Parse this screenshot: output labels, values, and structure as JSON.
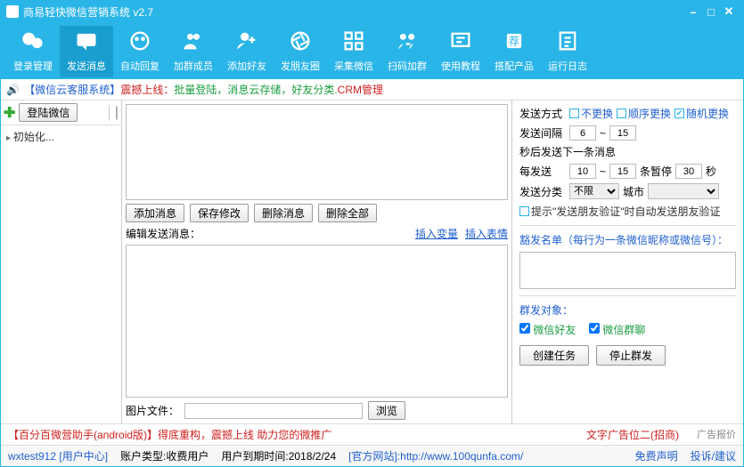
{
  "title": "商易轻快微信营销系统 v2.7",
  "toolbar": [
    {
      "label": "登录管理"
    },
    {
      "label": "发送消息"
    },
    {
      "label": "自动回复"
    },
    {
      "label": "加群成员"
    },
    {
      "label": "添加好友"
    },
    {
      "label": "发朋友圈"
    },
    {
      "label": "采集微信"
    },
    {
      "label": "扫码加群"
    },
    {
      "label": "使用教程"
    },
    {
      "label": "搭配产品"
    },
    {
      "label": "运行日志"
    }
  ],
  "announce": {
    "prefix_icon": "🔊",
    "p1": "【微信云客服系统】",
    "p2": "震撼上线：",
    "p3": "批量登陆，消息云存储，好友分类.",
    "p4": "CRM管理"
  },
  "left": {
    "add_login_btn": "登陆微信",
    "tree_root": "初始化..."
  },
  "mid": {
    "btn_add": "添加消息",
    "btn_save": "保存修改",
    "btn_del": "删除消息",
    "btn_delall": "删除全部",
    "edit_label": "编辑发送消息：",
    "link_var": "插入变量",
    "link_emoji": "插入表情",
    "file_label": "图片文件：",
    "browse": "浏览"
  },
  "right": {
    "send_mode_label": "发送方式",
    "mode_no": "不更换",
    "mode_seq": "顺序更换",
    "mode_rand": "随机更换",
    "interval_label": "发送间隔",
    "interval_from": "6",
    "interval_to": "15",
    "interval_suffix": "秒后发送下一条消息",
    "every_label": "每发送",
    "every_from": "10",
    "every_to": "15",
    "pause_mid": "条暂停",
    "pause_val": "30",
    "pause_suffix": "秒",
    "cat_label": "发送分类",
    "cat_opt": "不限",
    "city_label": "城市",
    "verify_chk": "提示\"发送朋友验证\"时自动发送朋友验证",
    "exempt_title": "豁发名单（每行为一条微信昵称或微信号）：",
    "target_title": "群发对象：",
    "target_friend": "微信好友",
    "target_group": "微信群聊",
    "btn_create": "创建任务",
    "btn_stop": "停止群发"
  },
  "footer1": {
    "ad1a": "【百分百微营助手(android版)】",
    "ad1b": "得底重构，震撼上线 助力您的微推广",
    "ad2": "文字广告位二(招商)",
    "adlink": "广告报价"
  },
  "footer2": {
    "user": "wxtest912",
    "user_center": "[用户中心]",
    "acct_type_label": "账户类型:",
    "acct_type": "收费用户",
    "expire_label": "用户到期时间:",
    "expire": "2018/2/24",
    "site_label": "[官方网站]:",
    "site_url": "http://www.100qunfa.com/",
    "disclaimer": "免费声明",
    "feedback": "投诉/建议"
  }
}
